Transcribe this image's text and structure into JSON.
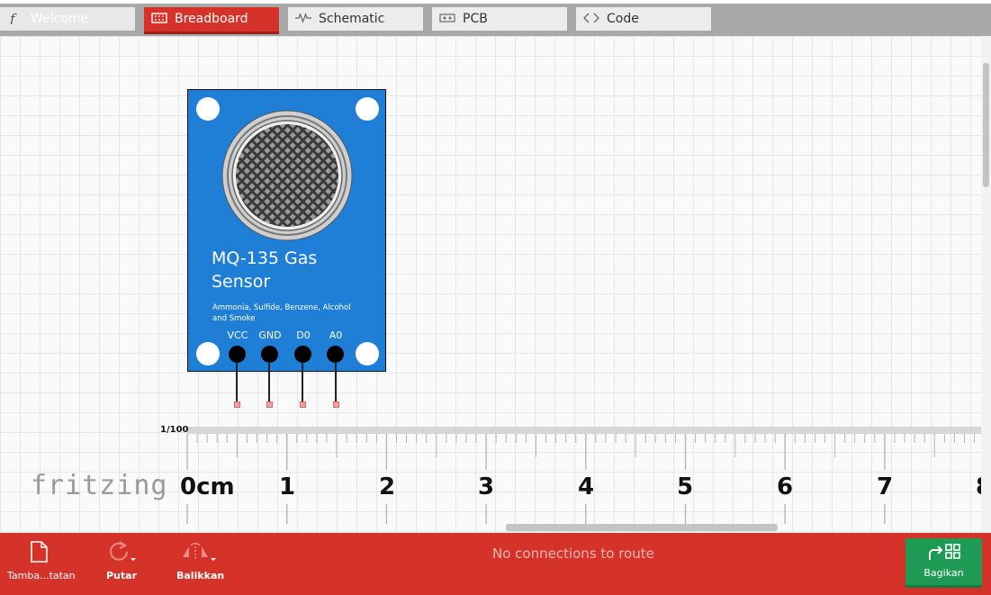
{
  "tabs": [
    {
      "label": "Welcome",
      "icon": "fritzing-f-icon"
    },
    {
      "label": "Breadboard",
      "icon": "breadboard-icon",
      "active": true
    },
    {
      "label": "Schematic",
      "icon": "resistor-icon"
    },
    {
      "label": "PCB",
      "icon": "pcb-icon"
    },
    {
      "label": "Code",
      "icon": "code-icon"
    }
  ],
  "sensor": {
    "title_line1": "MQ-135 Gas",
    "title_line2": "Sensor",
    "subtitle_line1": "Ammonia, Sulfide, Benzene, Alcohol",
    "subtitle_line2": "and Smoke",
    "pins": [
      "VCC",
      "GND",
      "D0",
      "A0"
    ],
    "color": "#1f7fd6"
  },
  "ruler": {
    "scale": "1/100",
    "labels": [
      "0cm",
      "1",
      "2",
      "3",
      "4",
      "5",
      "6",
      "7",
      "8"
    ]
  },
  "logo": "fritzing",
  "toolbar": {
    "add_note": "Tamba...tatan",
    "rotate": "Putar",
    "flip": "Balikkan",
    "status": "No connections to route",
    "share": "Bagikan"
  },
  "colors": {
    "accent": "#d5322a",
    "share": "#1e9a55"
  }
}
